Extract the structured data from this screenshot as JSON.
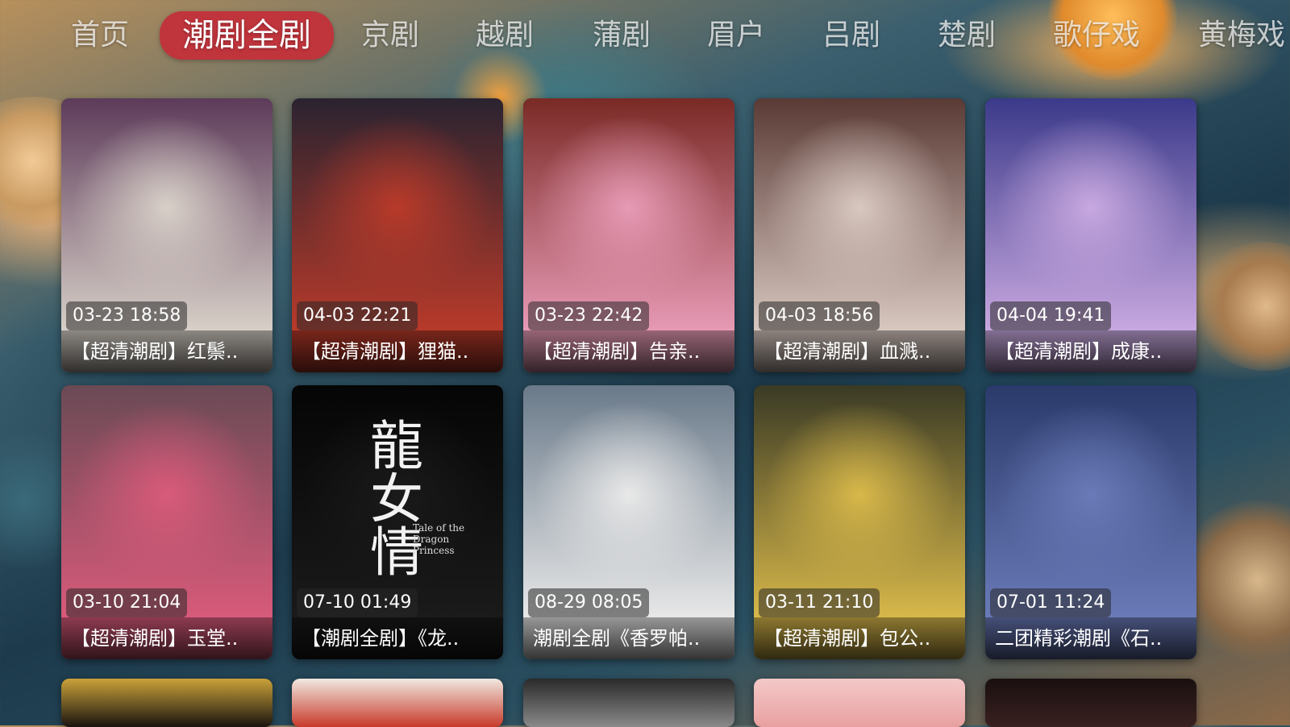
{
  "nav": {
    "tabs": [
      {
        "label": "首页",
        "active": false
      },
      {
        "label": "潮剧全剧",
        "active": true
      },
      {
        "label": "京剧",
        "active": false
      },
      {
        "label": "越剧",
        "active": false
      },
      {
        "label": "蒲剧",
        "active": false
      },
      {
        "label": "眉户",
        "active": false
      },
      {
        "label": "吕剧",
        "active": false
      },
      {
        "label": "楚剧",
        "active": false
      },
      {
        "label": "歌仔戏",
        "active": false
      },
      {
        "label": "黄梅戏",
        "active": false
      }
    ]
  },
  "videos": [
    {
      "time": "03-23 18:58",
      "title": "【超清潮剧】红鬃..",
      "palette": [
        "#5d3b5a",
        "#d8d0c8"
      ]
    },
    {
      "time": "04-03 22:21",
      "title": "【超清潮剧】狸猫..",
      "palette": [
        "#2a2330",
        "#b83a2a"
      ]
    },
    {
      "time": "03-23 22:42",
      "title": "【超清潮剧】告亲..",
      "palette": [
        "#7a2a25",
        "#e79ab5"
      ]
    },
    {
      "time": "04-03 18:56",
      "title": "【超清潮剧】血溅..",
      "palette": [
        "#5a3a35",
        "#d8c8c0"
      ]
    },
    {
      "time": "04-04 19:41",
      "title": "【超清潮剧】成康..",
      "palette": [
        "#3b3a8a",
        "#c8a8e0"
      ]
    },
    {
      "time": "03-10 21:04",
      "title": "【超清潮剧】玉堂..",
      "palette": [
        "#6a4a55",
        "#d85a7a"
      ]
    },
    {
      "time": "07-10 01:49",
      "title": "【潮剧全剧】《龙..",
      "palette": [
        "#050505",
        "#1a1a1a"
      ]
    },
    {
      "time": "08-29 08:05",
      "title": "潮剧全剧《香罗帕..",
      "palette": [
        "#6a7a8a",
        "#e8e8e8"
      ]
    },
    {
      "time": "03-11 21:10",
      "title": "【超清潮剧】包公..",
      "palette": [
        "#3a3a25",
        "#d8b84a"
      ]
    },
    {
      "time": "07-01 11:24",
      "title": "二团精彩潮剧《石..",
      "palette": [
        "#2a3a6a",
        "#6a7ab8"
      ]
    }
  ],
  "partial_row": [
    {
      "palette": [
        "#caa23a",
        "#1a1410"
      ]
    },
    {
      "palette": [
        "#f0e8e0",
        "#c83a2a"
      ]
    },
    {
      "palette": [
        "#2a2a2a",
        "#8a8a8a"
      ]
    },
    {
      "palette": [
        "#f4c8c8",
        "#e8a0a0"
      ]
    },
    {
      "palette": [
        "#1a1010",
        "#3a2020"
      ]
    }
  ],
  "thumb_overlay_text": {
    "dragon_vertical": "龍女情",
    "dragon_en": "Tale of the Dragon Princess"
  }
}
